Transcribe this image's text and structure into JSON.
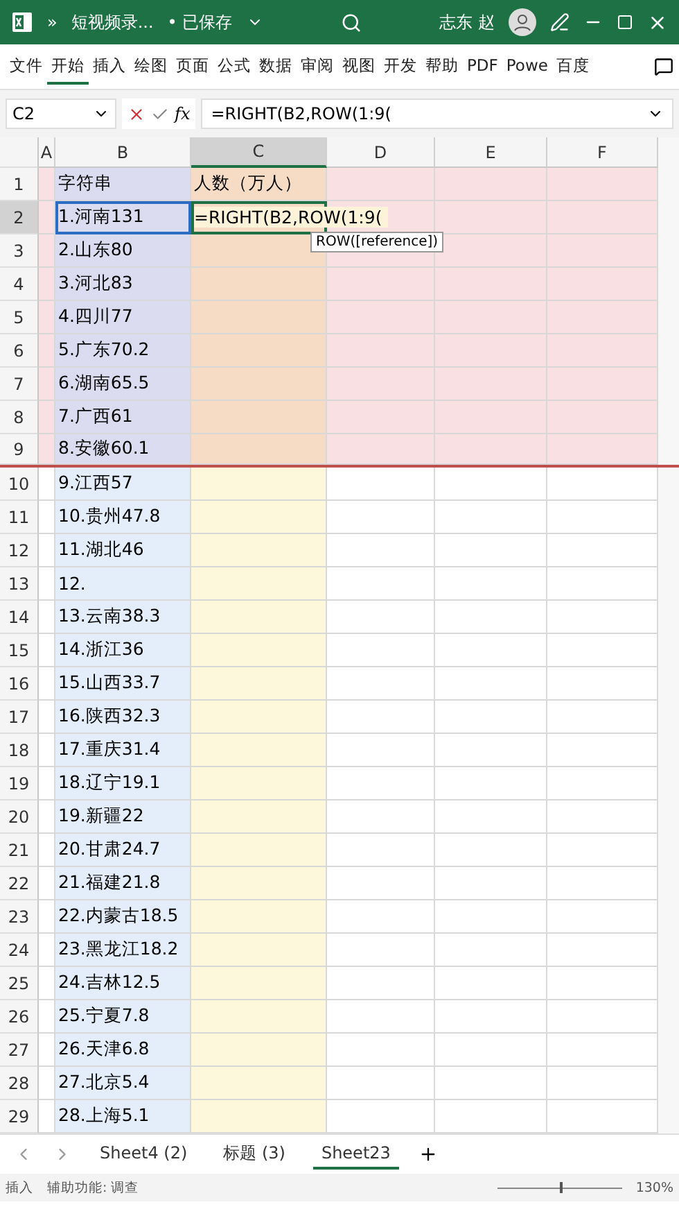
{
  "title_bar": {
    "more": "»",
    "file_name": "短视频录...",
    "save_status": "• 已保存",
    "user_name": "志东 赵"
  },
  "ribbon_tabs": [
    {
      "label": "文件",
      "selected": false
    },
    {
      "label": "开始",
      "selected": true
    },
    {
      "label": "插入",
      "selected": false
    },
    {
      "label": "绘图",
      "selected": false
    },
    {
      "label": "页面",
      "selected": false
    },
    {
      "label": "公式",
      "selected": false
    },
    {
      "label": "数据",
      "selected": false
    },
    {
      "label": "审阅",
      "selected": false
    },
    {
      "label": "视图",
      "selected": false
    },
    {
      "label": "开发",
      "selected": false
    },
    {
      "label": "帮助",
      "selected": false
    },
    {
      "label": "PDF",
      "selected": false
    },
    {
      "label": "Powe",
      "selected": false
    },
    {
      "label": "百度",
      "selected": false
    }
  ],
  "formula_bar": {
    "name_box": "C2",
    "fx": "fx",
    "formula": "=RIGHT(B2,ROW(1:9("
  },
  "columns": [
    {
      "label": "A",
      "selected": false
    },
    {
      "label": "B",
      "selected": false
    },
    {
      "label": "C",
      "selected": true
    },
    {
      "label": "D",
      "selected": false
    },
    {
      "label": "E",
      "selected": false
    },
    {
      "label": "F",
      "selected": false
    }
  ],
  "rows": [
    {
      "number": "1",
      "b": "字符串",
      "c": "人数（万人）",
      "highlighted": true,
      "selected": false
    },
    {
      "number": "2",
      "b": "1.河南131",
      "c": "=RIGHT(B2,ROW(1:9(",
      "highlighted": true,
      "selected": true
    },
    {
      "number": "3",
      "b": "2.山东80",
      "highlighted": true,
      "selected": false
    },
    {
      "number": "4",
      "b": "3.河北83",
      "highlighted": true,
      "selected": false
    },
    {
      "number": "5",
      "b": "4.四川77",
      "highlighted": true,
      "selected": false
    },
    {
      "number": "6",
      "b": "5.广东70.2",
      "highlighted": true,
      "selected": false
    },
    {
      "number": "7",
      "b": "6.湖南65.5",
      "highlighted": true,
      "selected": false
    },
    {
      "number": "8",
      "b": "7.广西61",
      "highlighted": true,
      "selected": false
    },
    {
      "number": "9",
      "b": "8.安徽60.1",
      "highlighted": true,
      "selected": false
    },
    {
      "number": "10",
      "b": "9.江西57",
      "highlighted": false,
      "selected": false
    },
    {
      "number": "11",
      "b": "10.贵州47.8",
      "highlighted": false,
      "selected": false
    },
    {
      "number": "12",
      "b": "11.湖北46",
      "highlighted": false,
      "selected": false
    },
    {
      "number": "13",
      "b": "12.",
      "highlighted": false,
      "selected": false
    },
    {
      "number": "14",
      "b": "13.云南38.3",
      "highlighted": false,
      "selected": false
    },
    {
      "number": "15",
      "b": "14.浙江36",
      "highlighted": false,
      "selected": false
    },
    {
      "number": "16",
      "b": "15.山西33.7",
      "highlighted": false,
      "selected": false
    },
    {
      "number": "17",
      "b": "16.陕西32.3",
      "highlighted": false,
      "selected": false
    },
    {
      "number": "18",
      "b": "17.重庆31.4",
      "highlighted": false,
      "selected": false
    },
    {
      "number": "19",
      "b": "18.辽宁19.1",
      "highlighted": false,
      "selected": false
    },
    {
      "number": "20",
      "b": "19.新疆22",
      "highlighted": false,
      "selected": false
    },
    {
      "number": "21",
      "b": "20.甘肃24.7",
      "highlighted": false,
      "selected": false
    },
    {
      "number": "22",
      "b": "21.福建21.8",
      "highlighted": false,
      "selected": false
    },
    {
      "number": "23",
      "b": "22.内蒙古18.5",
      "highlighted": false,
      "selected": false
    },
    {
      "number": "24",
      "b": "23.黑龙江18.2",
      "highlighted": false,
      "selected": false
    },
    {
      "number": "25",
      "b": "24.吉林12.5",
      "highlighted": false,
      "selected": false
    },
    {
      "number": "26",
      "b": "25.宁夏7.8",
      "highlighted": false,
      "selected": false
    },
    {
      "number": "27",
      "b": "26.天津6.8",
      "highlighted": false,
      "selected": false
    },
    {
      "number": "28",
      "b": "27.北京5.4",
      "highlighted": false,
      "selected": false
    },
    {
      "number": "29",
      "b": "28.上海5.1",
      "highlighted": false,
      "selected": false
    }
  ],
  "tooltip": "ROW([reference])",
  "sheet_tabs": [
    {
      "label": "Sheet4 (2)",
      "selected": false
    },
    {
      "label": "标题 (3)",
      "selected": false
    },
    {
      "label": "Sheet23",
      "selected": true
    }
  ],
  "status_bar": {
    "mode": "插入",
    "accessibility": "辅助功能: 调查",
    "zoom": "130%",
    "zoom_slider": {
      "level": 0.5
    }
  }
}
